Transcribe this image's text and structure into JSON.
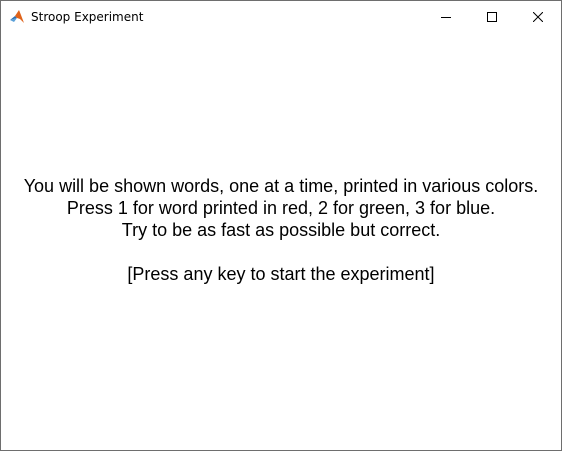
{
  "window": {
    "title": "Stroop Experiment",
    "app_icon": "matlab-icon",
    "controls": {
      "minimize_icon": "minimize-icon",
      "maximize_icon": "maximize-icon",
      "close_icon": "close-icon"
    }
  },
  "instructions": {
    "line1": "You will be shown words, one at a time, printed in various colors.",
    "line2": "Press 1 for word printed in red, 2 for green, 3 for blue.",
    "line3": "Try to be as fast as possible but correct.",
    "prompt": "[Press any key to start the experiment]"
  },
  "colors": {
    "background": "#ffffff",
    "text": "#000000",
    "border": "#6e6e6e"
  }
}
